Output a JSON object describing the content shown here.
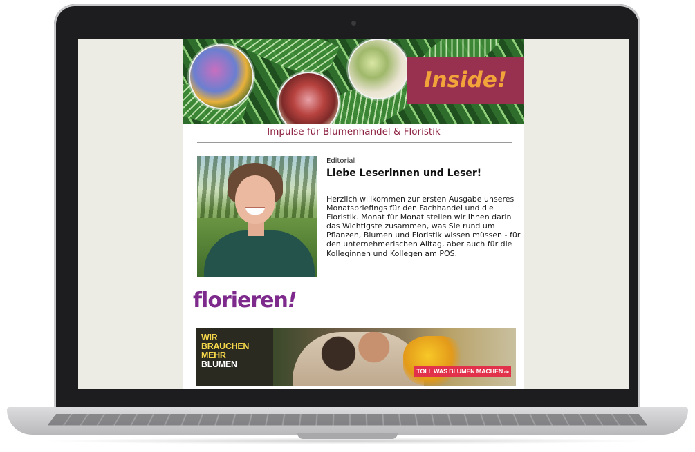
{
  "newsletter": {
    "header": {
      "badge_text": "Inside!"
    },
    "tagline": "Impulse für Blumenhandel & Floristik",
    "editorial": {
      "label": "Editorial",
      "title": "Liebe Leserinnen und Leser!",
      "body": "Herzlich willkommen zur ersten Ausgabe unseres Monatsbriefings für den Fachhandel und die Floristik. Monat für Monat stellen wir Ihnen darin das Wichtigste zusammen, was Sie rund um Pflanzen, Blumen und Floristik wissen müssen - für den unternehmerischen Alltag, aber auch für die Kolleginnen und Kollegen am POS."
    },
    "brand_logo": {
      "word": "florieren",
      "mark": "!"
    },
    "promo": {
      "headline_lines": [
        "WIR",
        "BRAUCHEN",
        "MEHR",
        "BLUMEN"
      ],
      "slogan_prefix": "TOLL WAS ",
      "slogan_highlight": "BLUMEN",
      "slogan_suffix": " MACHEN",
      "slogan_mark": "de"
    },
    "colors": {
      "brand_wine": "#98314f",
      "badge_text": "#f2a43a",
      "tagline": "#8d2240",
      "florieren_purple": "#7d2a8c",
      "promo_yellow": "#f4d64a",
      "promo_red": "#e2314b"
    }
  }
}
